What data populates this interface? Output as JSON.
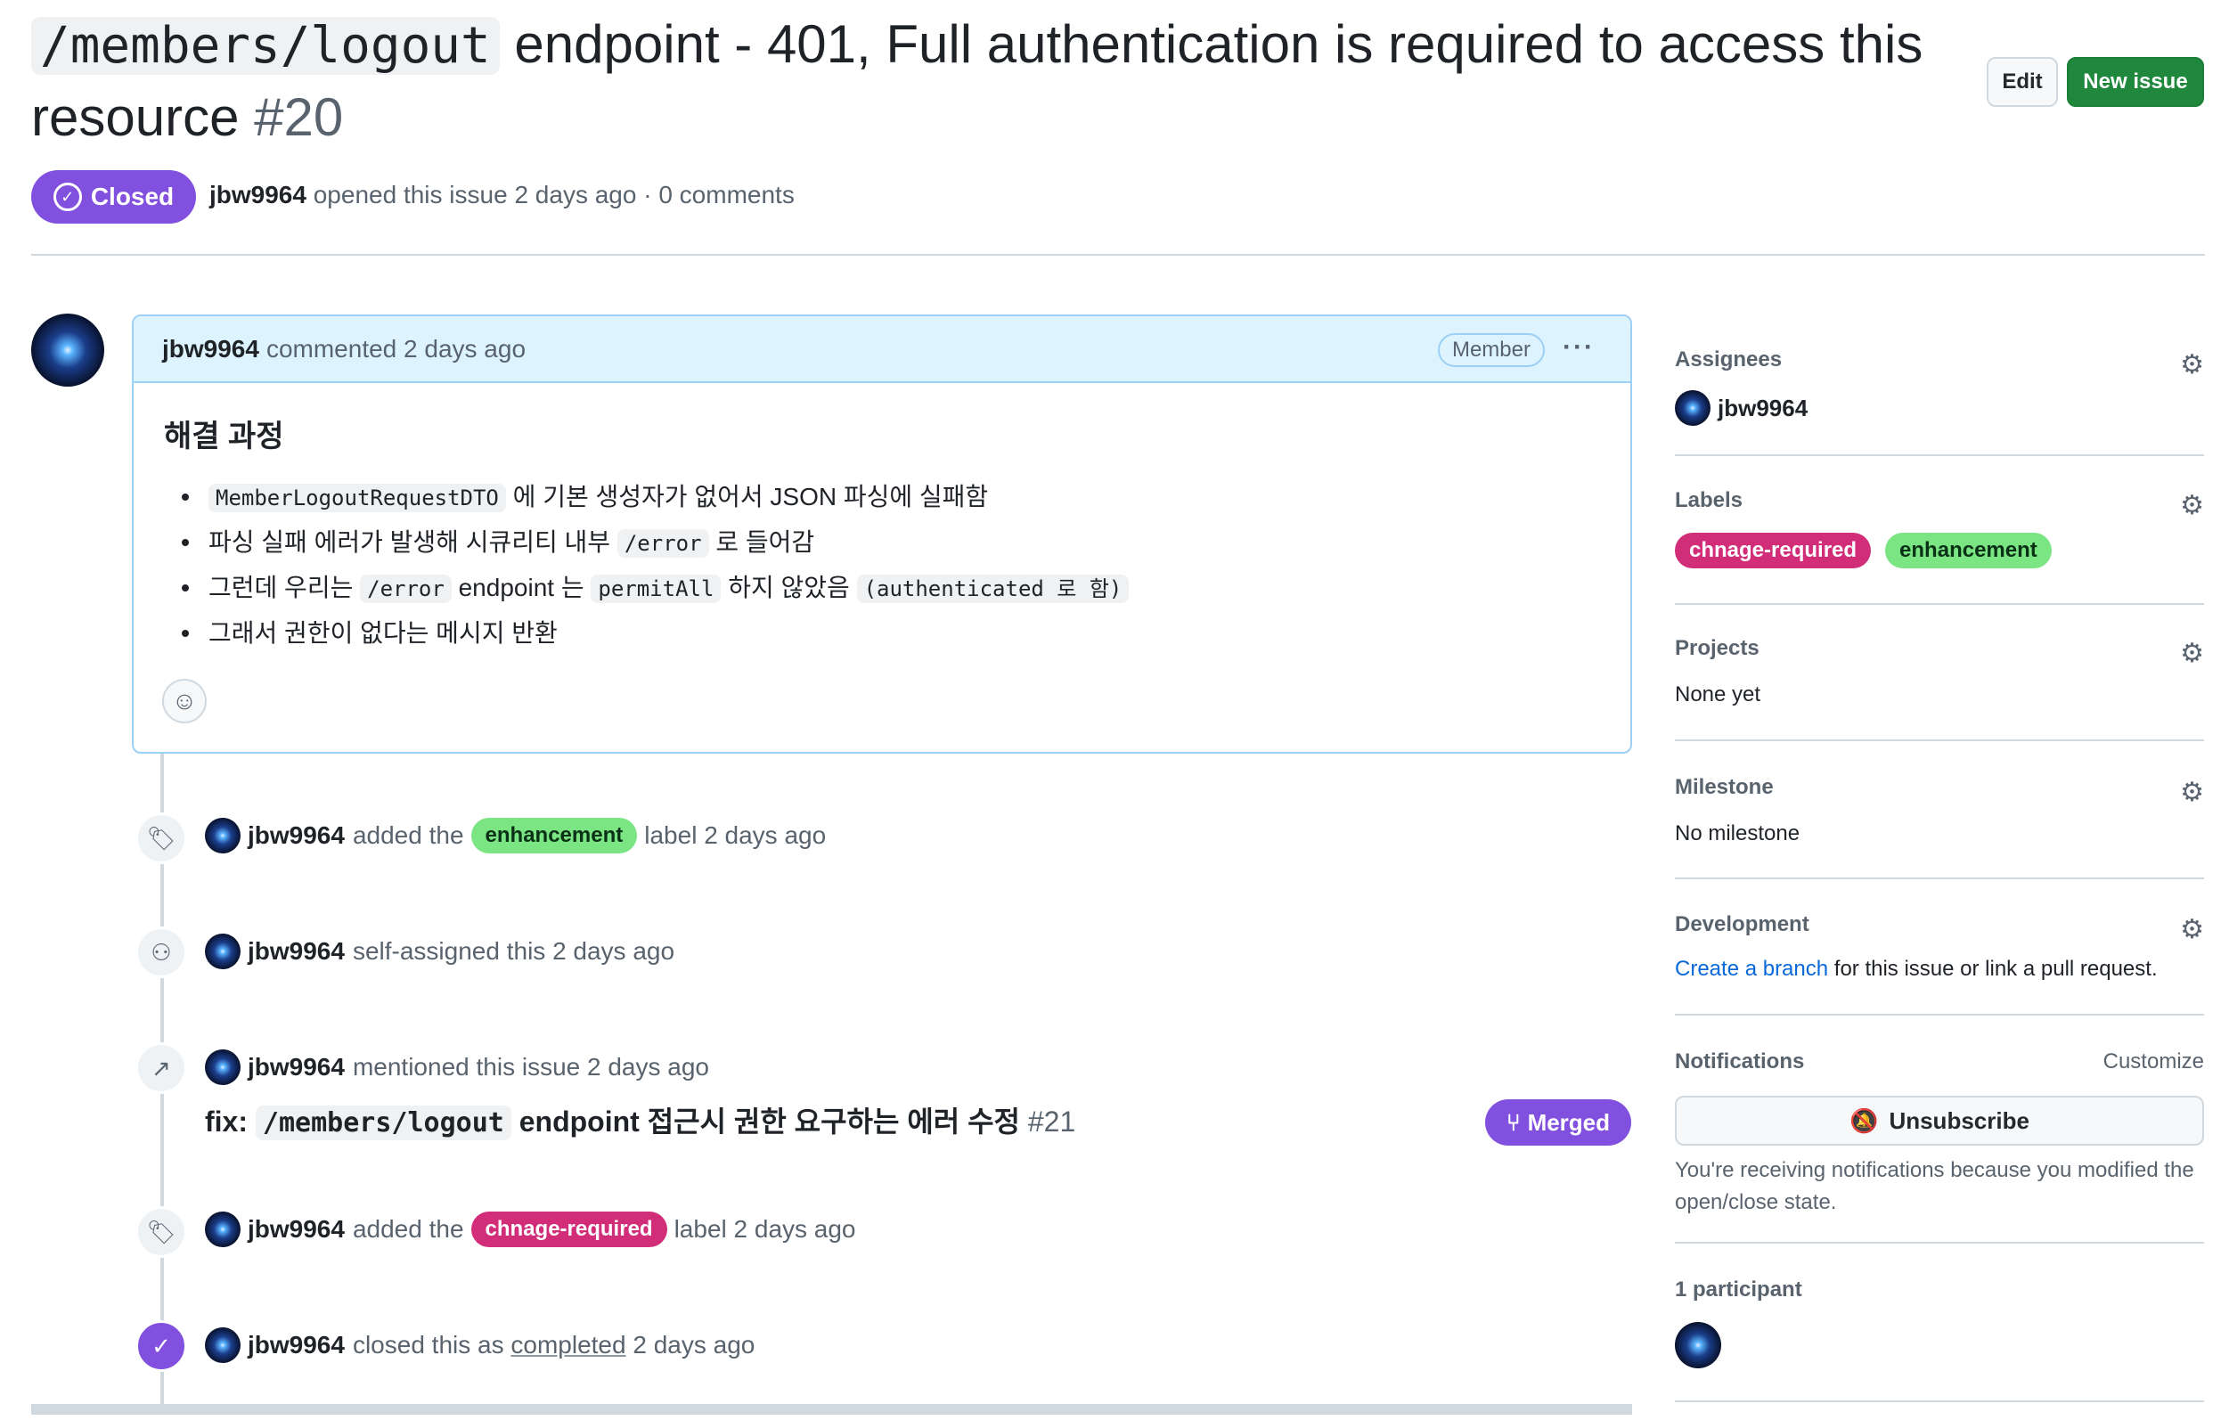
{
  "header": {
    "title_code": "/members/logout",
    "title_text": " endpoint - 401, Full authentication is required to access this resource ",
    "issue_number": "#20",
    "edit_label": "Edit",
    "new_issue_label": "New issue",
    "state_label": "Closed",
    "author": "jbw9964",
    "meta_text": " opened this issue 2 days ago · 0 comments"
  },
  "comment": {
    "author": "jbw9964",
    "time_text": "commented 2 days ago",
    "role_badge": "Member",
    "heading": "해결 과정",
    "bullets": {
      "b1_code": "MemberLogoutRequestDTO",
      "b1_text": " 에 기본 생성자가 없어서 JSON 파싱에 실패함",
      "b2_text1": "파싱 실패 에러가 발생해 시큐리티 내부 ",
      "b2_code": "/error",
      "b2_text2": " 로 들어감",
      "b3_text1": "그런데 우리는 ",
      "b3_code1": "/error",
      "b3_text2": " endpoint 는 ",
      "b3_code2": "permitAll",
      "b3_text3": " 하지 않았음 ",
      "b3_code3": "(authenticated 로 함)",
      "b4_text": "그래서 권한이 없다는 메시지 반환"
    }
  },
  "timeline": {
    "e1": {
      "author": "jbw9964",
      "pre": "added the",
      "label": "enhancement",
      "post": "label 2 days ago"
    },
    "e2": {
      "author": "jbw9964",
      "text": "self-assigned this 2 days ago"
    },
    "e3": {
      "author": "jbw9964",
      "text": "mentioned this issue 2 days ago"
    },
    "pr": {
      "prefix": "fix: ",
      "code": "/members/logout",
      "text": " endpoint 접근시 권한 요구하는 에러 수정 ",
      "number": "#21",
      "status": "Merged"
    },
    "e4": {
      "author": "jbw9964",
      "pre": "added the",
      "label": "chnage-required",
      "post": "label 2 days ago"
    },
    "e5": {
      "author": "jbw9964",
      "pre": "closed this as",
      "link": "completed",
      "post": "2 days ago"
    }
  },
  "sidebar": {
    "assignees_title": "Assignees",
    "assignee_name": "jbw9964",
    "labels_title": "Labels",
    "label_1": "chnage-required",
    "label_2": "enhancement",
    "projects_title": "Projects",
    "projects_value": "None yet",
    "milestone_title": "Milestone",
    "milestone_value": "No milestone",
    "development_title": "Development",
    "development_link": "Create a branch",
    "development_text": " for this issue or link a pull request.",
    "notifications_title": "Notifications",
    "customize_label": "Customize",
    "unsubscribe_label": "Unsubscribe",
    "notifications_note": "You're receiving notifications because you modified the open/close state.",
    "participants_title": "1 participant"
  },
  "colors": {
    "closed_purple": "#8250df",
    "new_issue_green": "#1f883d",
    "label_enhancement": "#7ae582",
    "label_chnage_required": "#d12d78",
    "link_blue": "#0969da"
  },
  "icons": [
    "check-circle-icon",
    "smiley-icon",
    "tag-icon",
    "person-icon",
    "cross-reference-icon",
    "git-merge-icon",
    "gear-icon",
    "bell-slash-icon",
    "kebab-icon"
  ]
}
